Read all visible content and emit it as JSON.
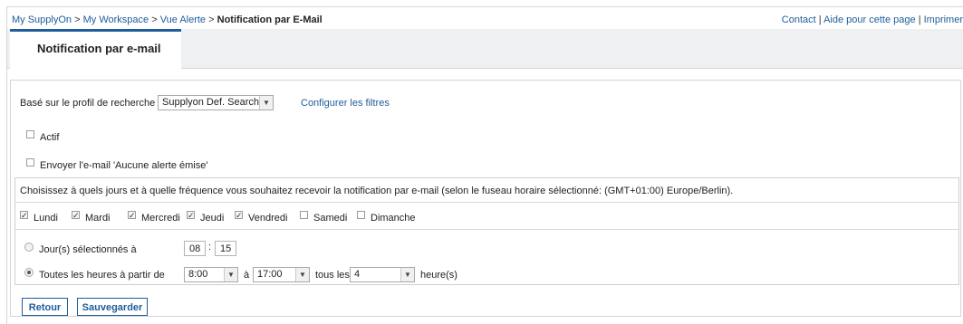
{
  "breadcrumb": {
    "items": [
      "My SupplyOn",
      "My Workspace",
      "Vue Alerte"
    ],
    "separator": ">",
    "current": "Notification par E-Mail"
  },
  "toplinks": {
    "contact": "Contact",
    "help": "Aide pour cette page",
    "print": "Imprimer",
    "separator": "|"
  },
  "tab": {
    "label": "Notification par e-mail"
  },
  "profile": {
    "label": "Basé sur le profil de recherche",
    "selected": "Supplyon Def. Search",
    "configure_link": "Configurer les filtres"
  },
  "actif": {
    "label": "Actif",
    "checked": false
  },
  "no_alert_email": {
    "label": "Envoyer l'e-mail 'Aucune alerte émise'",
    "checked": false
  },
  "schedule": {
    "instruction": "Choisissez à quels jours et à quelle fréquence vous souhaitez recevoir la notification par e-mail (selon le fuseau horaire sélectionné: (GMT+01:00) Europe/Berlin).",
    "days": [
      {
        "label": "Lundi",
        "checked": true
      },
      {
        "label": "Mardi",
        "checked": true
      },
      {
        "label": "Mercredi",
        "checked": true
      },
      {
        "label": "Jeudi",
        "checked": true
      },
      {
        "label": "Vendredi",
        "checked": true
      },
      {
        "label": "Samedi",
        "checked": false
      },
      {
        "label": "Dimanche",
        "checked": false
      }
    ],
    "option_fixed": {
      "label": "Jour(s) sélectionnés à",
      "selected": false,
      "hour": "08",
      "colon": ":",
      "minute": "15"
    },
    "option_hourly": {
      "label": "Toutes les heures à partir de",
      "selected": true,
      "from": "8:00",
      "to_label": "à",
      "to": "17:00",
      "every_label": "tous les",
      "every": "4",
      "unit_label": "heure(s)"
    }
  },
  "buttons": {
    "back": "Retour",
    "save": "Sauvegarder"
  },
  "colors": {
    "accent": "#1e5d99",
    "tab_strip": "#eef0f2"
  }
}
